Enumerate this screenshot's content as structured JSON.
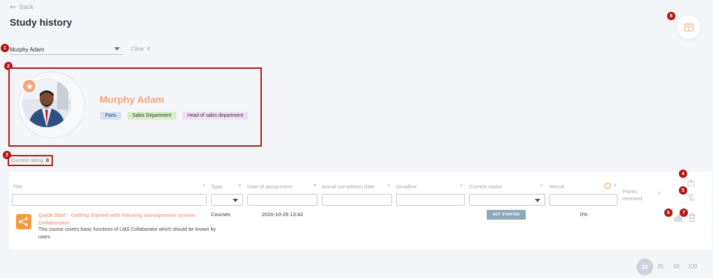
{
  "header": {
    "back_label": "Back",
    "page_title": "Study history"
  },
  "markers": [
    "1",
    "2",
    "3",
    "4",
    "5",
    "6",
    "7",
    "8"
  ],
  "filter": {
    "selected_user": "Murphy Adam",
    "clear_label": "Clear"
  },
  "profile": {
    "name": "Murphy Adam",
    "tags": [
      "Paris",
      "Sales Department",
      "Head of sales department"
    ]
  },
  "rating": {
    "label": "Current rating:",
    "value": "0"
  },
  "table": {
    "columns": [
      "Title",
      "Type",
      "Date of assignment",
      "Actual completion date",
      "Deadline",
      "Current status",
      "Result",
      "Points received"
    ],
    "rows": [
      {
        "title": "Quick Start - Getting Started with learning management system Collaborator",
        "description": "This course covers basic functions of LMS Collaborator which should be known by users",
        "type": "Courses",
        "date_assigned": "2020-10-26 13:42",
        "completion": "",
        "deadline": "",
        "status": "NOT STARTED",
        "result": "0%"
      }
    ]
  },
  "pagination": {
    "options": [
      "10",
      "25",
      "50",
      "100"
    ],
    "active": "10"
  },
  "colors": {
    "accent": "#f5a37d",
    "marker": "#b01717",
    "status_pill": "#8ea8b8",
    "course_icon": "#f39a3d"
  }
}
